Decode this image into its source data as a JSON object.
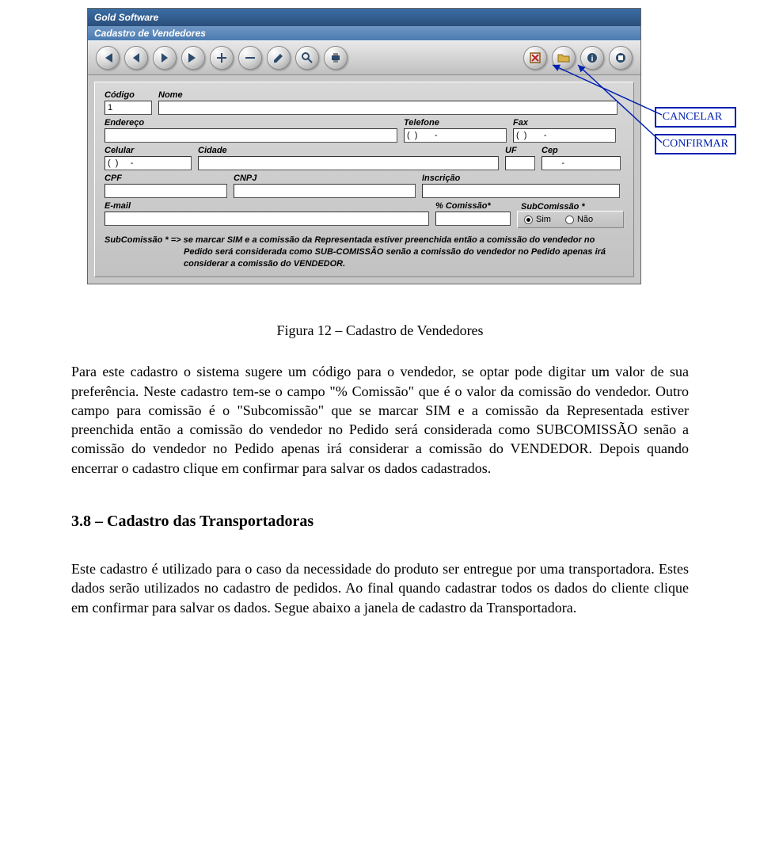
{
  "window": {
    "app_title": "Gold Software",
    "subtitle": "Cadastro de Vendedores"
  },
  "toolbar": {
    "buttons": [
      {
        "name": "first",
        "glyph": "⏮"
      },
      {
        "name": "prev",
        "glyph": "◀"
      },
      {
        "name": "next",
        "glyph": "▶"
      },
      {
        "name": "last",
        "glyph": "⏭"
      },
      {
        "name": "add",
        "glyph": "＋"
      },
      {
        "name": "delete",
        "glyph": "−"
      },
      {
        "name": "edit",
        "glyph": "✎"
      },
      {
        "name": "search",
        "glyph": "🔍"
      },
      {
        "name": "print",
        "glyph": "🖨"
      },
      {
        "name": "cancel",
        "glyph": "✖"
      },
      {
        "name": "confirm",
        "glyph": "📂"
      },
      {
        "name": "help",
        "glyph": "ℹ"
      },
      {
        "name": "exit",
        "glyph": "⏏"
      }
    ]
  },
  "labels": {
    "codigo": "Código",
    "nome": "Nome",
    "endereco": "Endereço",
    "telefone": "Telefone",
    "fax": "Fax",
    "celular": "Celular",
    "cidade": "Cidade",
    "uf": "UF",
    "cep": "Cep",
    "cpf": "CPF",
    "cnpj": "CNPJ",
    "inscricao": "Inscrição",
    "email": "E-mail",
    "comissao": "% Comissão*",
    "subcom_legend": "SubComissão *",
    "sim": "Sim",
    "nao": "Não"
  },
  "values": {
    "codigo": "1",
    "nome": "",
    "endereco": "",
    "telefone": "(  )       -",
    "fax": "(  )       -",
    "celular": "(  )     -",
    "cidade": "",
    "uf": "",
    "cep": "       -",
    "cpf": "",
    "cnpj": "",
    "inscricao": "",
    "email": "",
    "comissao": "",
    "subcom_selected": "sim"
  },
  "help_note": "SubComissão * => se marcar SIM e a comissão da Representada estiver preenchida então a comissão do vendedor no Pedido será considerada como SUB-COMISSÃO senão a comissão do vendedor no Pedido apenas irá considerar a comissão do VENDEDOR.",
  "callouts": {
    "cancelar": "CANCELAR",
    "confirmar": "CONFIRMAR"
  },
  "figure_caption": "Figura 12 – Cadastro de Vendedores",
  "paragraph1": "Para este cadastro o sistema sugere um código para o vendedor, se optar pode digitar um valor de sua preferência. Neste cadastro tem-se o campo \"% Comissão\" que é o valor da comissão do vendedor. Outro campo para comissão é o \"Subcomissão\" que se marcar SIM e a comissão da Representada estiver preenchida então a comissão do vendedor no Pedido será considerada como SUBCOMISSÃO senão a comissão do vendedor no Pedido apenas irá considerar a comissão do VENDEDOR. Depois quando encerrar o cadastro clique em confirmar para salvar os dados cadastrados.",
  "section_heading": "3.8 – Cadastro das Transportadoras",
  "paragraph2": "Este cadastro é utilizado para o caso da necessidade do produto ser entregue por uma transportadora. Estes dados serão utilizados no cadastro de pedidos.  Ao final quando cadastrar todos os dados do cliente clique em confirmar para salvar os dados. Segue abaixo a janela de cadastro da Transportadora."
}
